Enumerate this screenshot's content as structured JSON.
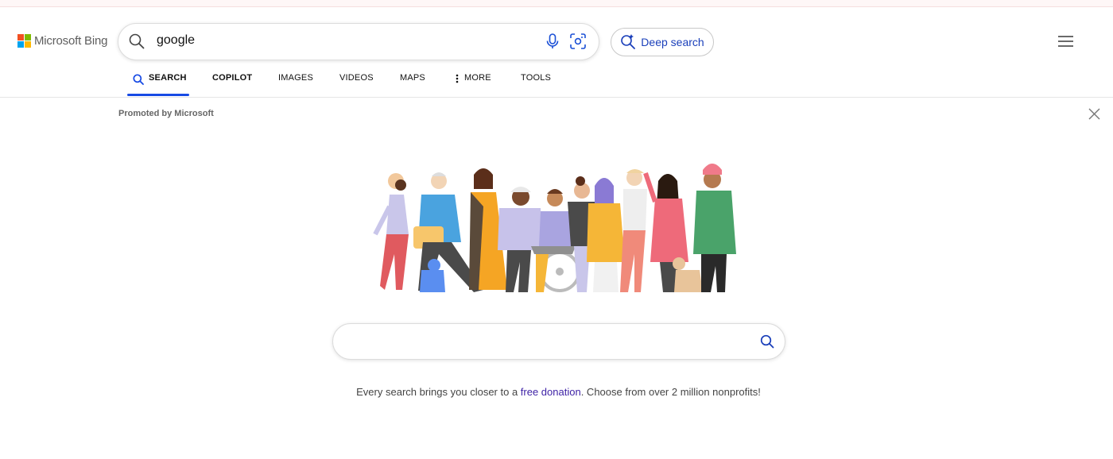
{
  "logo": {
    "text": "Microsoft Bing"
  },
  "search": {
    "query": "google"
  },
  "deep_search": {
    "label": "Deep search"
  },
  "tabs": [
    {
      "label": "SEARCH",
      "active": true
    },
    {
      "label": "COPILOT"
    },
    {
      "label": "IMAGES"
    },
    {
      "label": "VIDEOS"
    },
    {
      "label": "MAPS"
    },
    {
      "label": "MORE"
    },
    {
      "label": "TOOLS"
    }
  ],
  "promo": {
    "label": "Promoted by Microsoft",
    "search_placeholder": "",
    "text_before": "Every search brings you closer to a ",
    "link_text": "free donation",
    "text_after": ". Choose from over 2 million nonprofits!"
  },
  "icons": {
    "search": "search-icon",
    "mic": "microphone-icon",
    "visual": "visual-search-icon",
    "deep": "deep-search-icon",
    "menu": "hamburger-menu-icon",
    "more": "more-dots-icon",
    "close": "close-icon"
  },
  "colors": {
    "accent_blue": "#174ae4",
    "link_purple": "#3f23a6",
    "deep_blue": "#1a3fba"
  }
}
